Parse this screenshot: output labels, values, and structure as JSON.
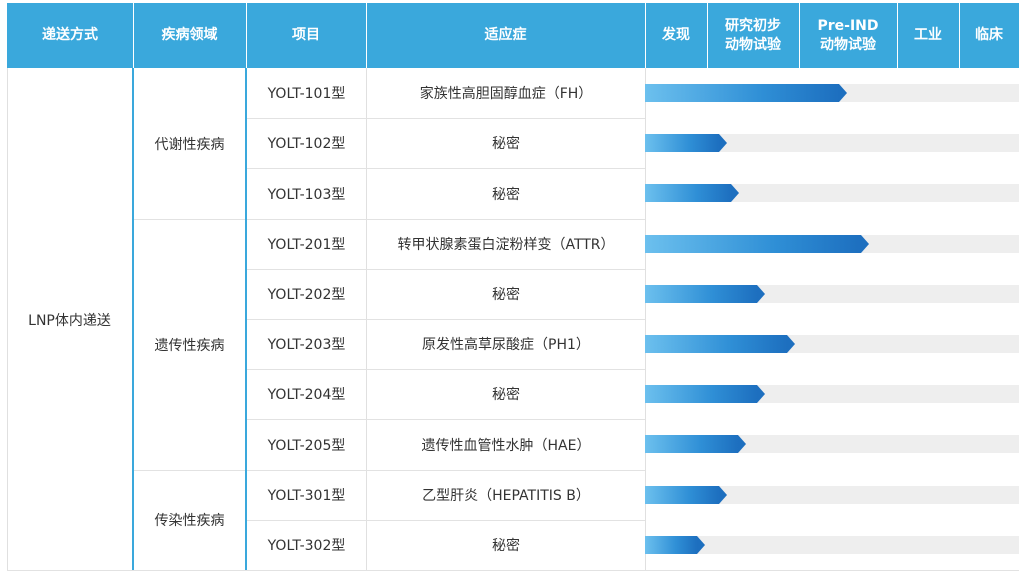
{
  "headers": {
    "delivery": "递送方式",
    "area": "疾病领域",
    "project": "项目",
    "indication": "适应症",
    "discovery": "发现",
    "research_l1": "研究初步",
    "research_l2": "动物试验",
    "preind_l1": "Pre-IND",
    "preind_l2": "动物试验",
    "industrial": "工业",
    "clinical": "临床"
  },
  "delivery": {
    "label": "LNP体内递送"
  },
  "areas": [
    {
      "label": "代谢性疾病"
    },
    {
      "label": "遗传性疾病"
    },
    {
      "label": "传染性疾病"
    }
  ],
  "rows": [
    {
      "project": "YOLT-101型",
      "indication": "家族性高胆固醇血症（FH）",
      "progress": 0.54
    },
    {
      "project": "YOLT-102型",
      "indication": "秘密",
      "progress": 0.22
    },
    {
      "project": "YOLT-103型",
      "indication": "秘密",
      "progress": 0.25
    },
    {
      "project": "YOLT-201型",
      "indication": "转甲状腺素蛋白淀粉样变（ATTR）",
      "progress": 0.6
    },
    {
      "project": "YOLT-202型",
      "indication": "秘密",
      "progress": 0.32
    },
    {
      "project": "YOLT-203型",
      "indication": "原发性高草尿酸症（PH1）",
      "progress": 0.4
    },
    {
      "project": "YOLT-204型",
      "indication": "秘密",
      "progress": 0.32
    },
    {
      "project": "YOLT-205型",
      "indication": "遗传性血管性水肿（HAE）",
      "progress": 0.27
    },
    {
      "project": "YOLT-301型",
      "indication": "乙型肝炎（HEPATITIS B）",
      "progress": 0.22
    },
    {
      "project": "YOLT-302型",
      "indication": "秘密",
      "progress": 0.16
    }
  ],
  "colors": {
    "header_bg": "#3aa8dc",
    "bar_start": "#6cc0ee",
    "bar_end": "#1d6fbf",
    "track": "#eeeeee"
  }
}
